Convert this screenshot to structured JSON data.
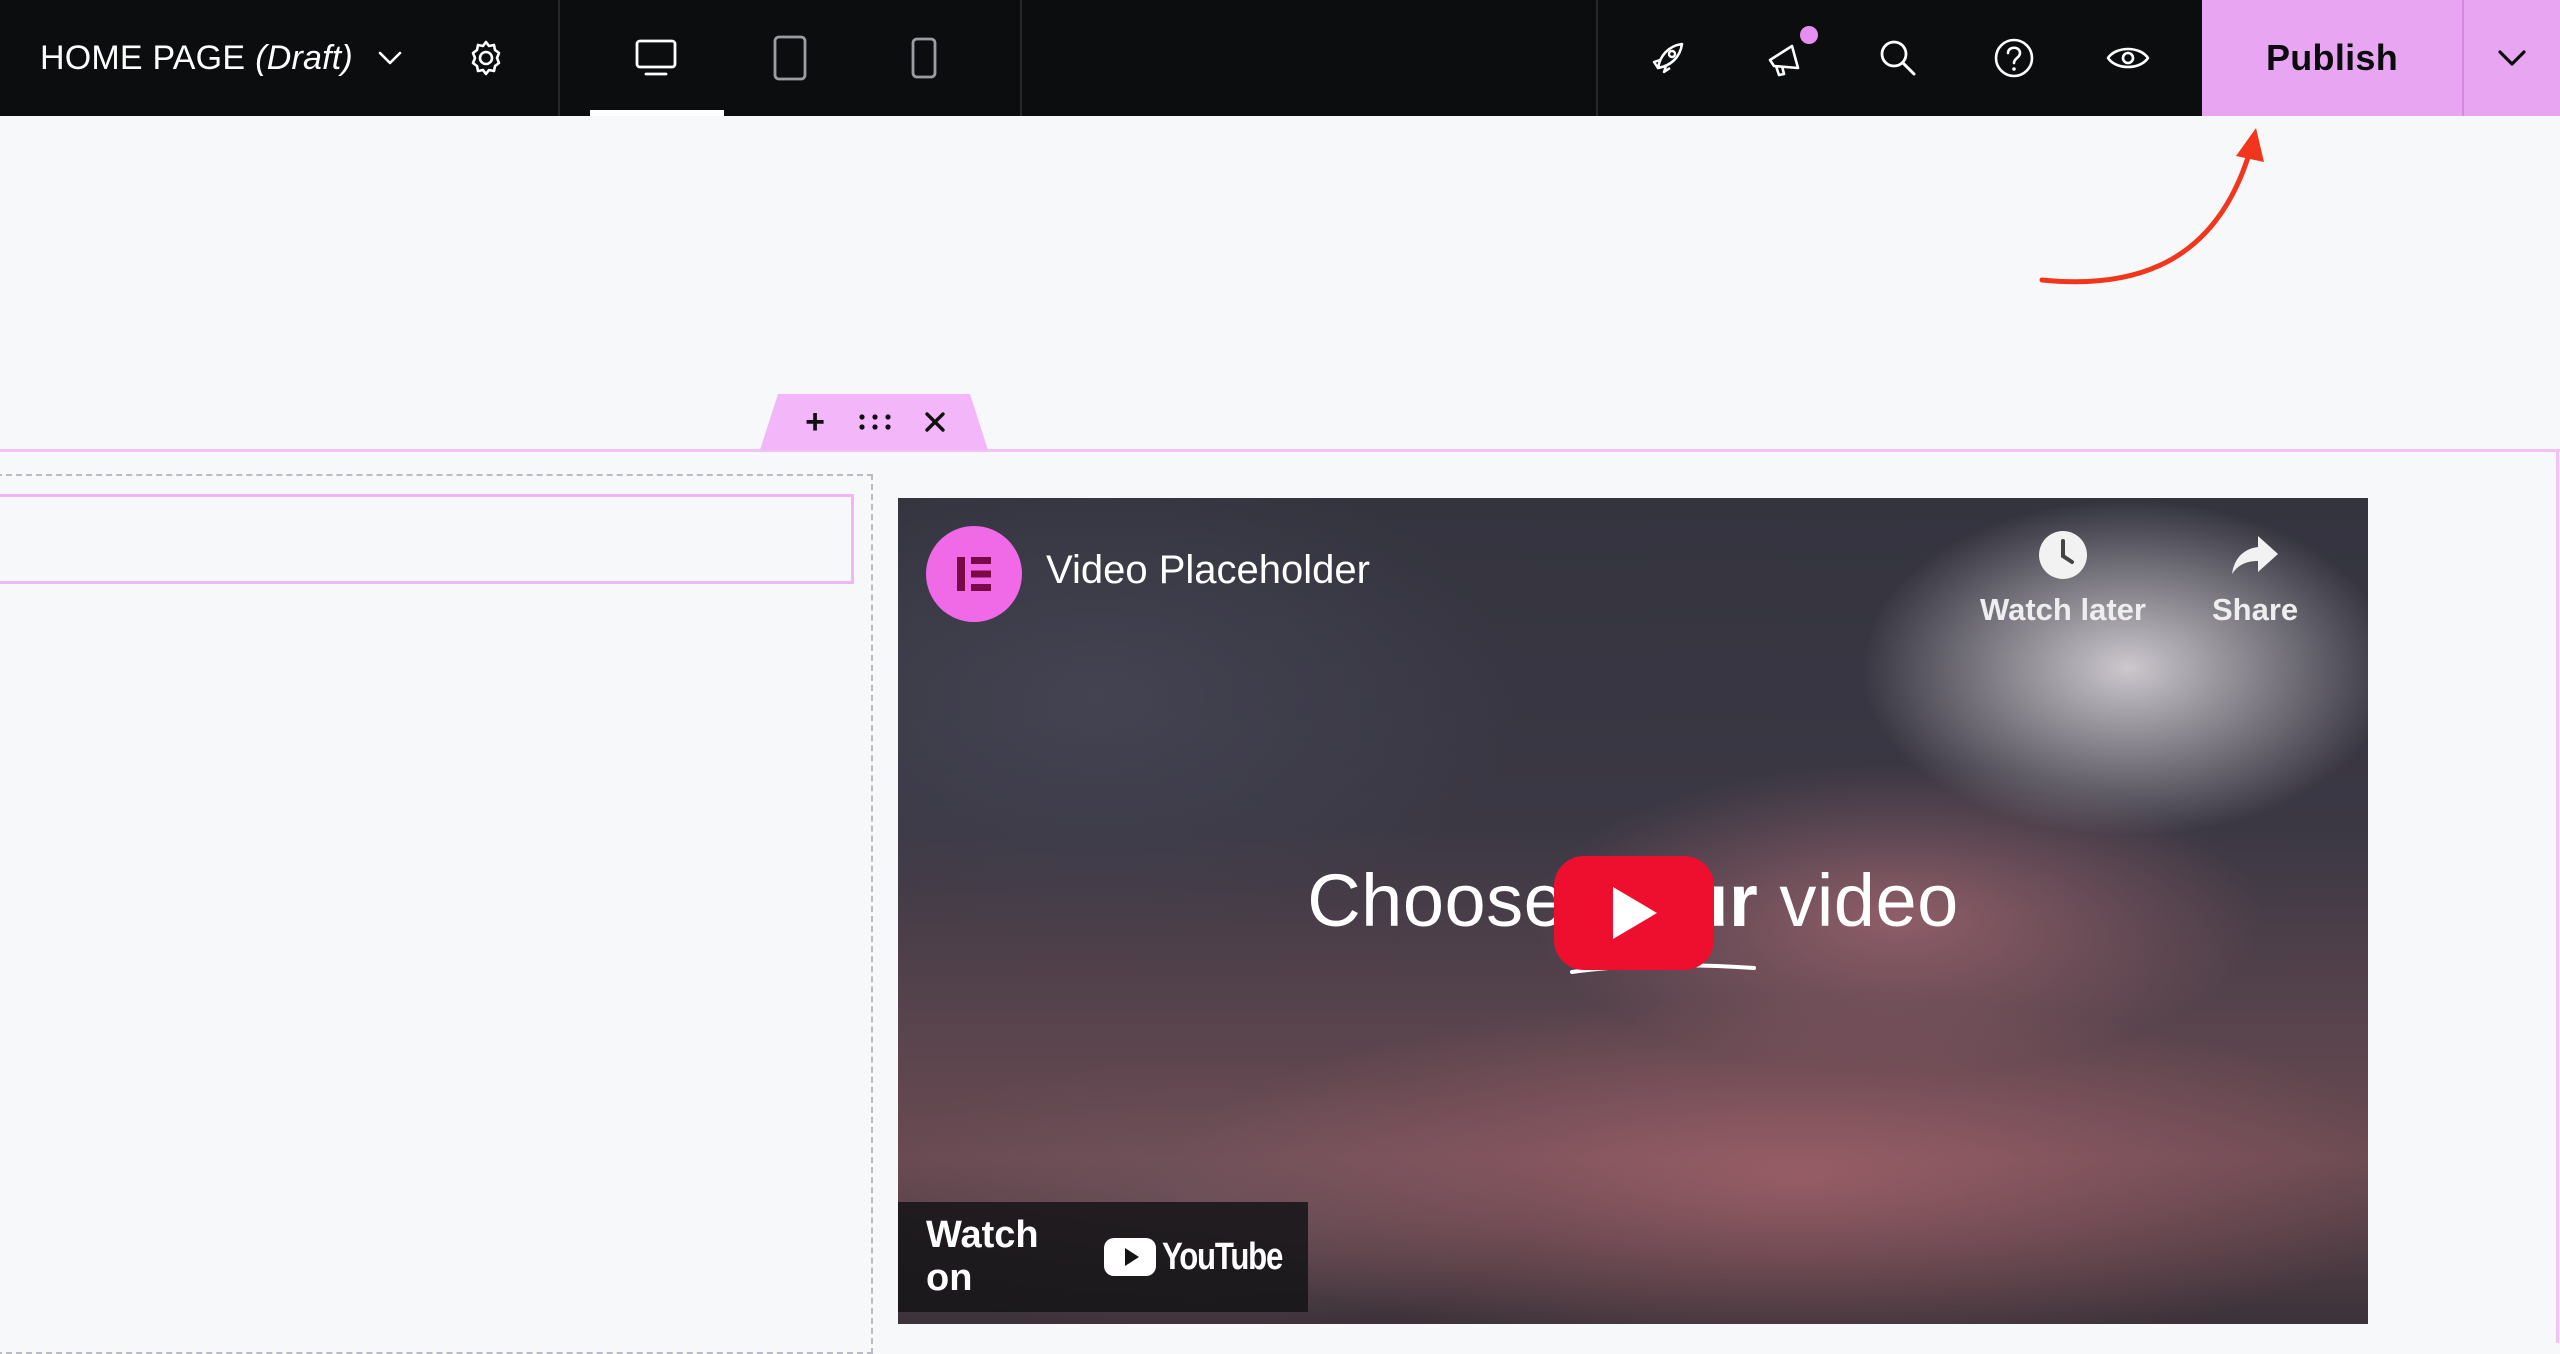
{
  "toolbar": {
    "page_title": "HOME PAGE",
    "page_status": "(Draft)",
    "devices": [
      "desktop",
      "tablet",
      "mobile"
    ],
    "active_device": "desktop",
    "publish_label": "Publish",
    "accent_color": "#e8a6f2"
  },
  "icons": {
    "title_dropdown": "chevron-down-icon",
    "settings": "gear-icon",
    "desktop": "desktop-icon",
    "tablet": "tablet-icon",
    "mobile": "mobile-icon",
    "launch": "rocket-icon",
    "whats_new": "megaphone-icon",
    "search": "search-icon",
    "help": "help-circle-icon",
    "preview": "eye-icon",
    "publish_more": "chevron-down-icon"
  },
  "section_handle": {
    "add": "+",
    "drag": "⠿",
    "remove": "×"
  },
  "video": {
    "title": "Video Placeholder",
    "watch_later": "Watch later",
    "share": "Share",
    "headline_pre": "Choose",
    "headline_mid": "ur",
    "headline_post": "video",
    "watch_on": "Watch on",
    "brand": "YouTube",
    "play_color": "#ee0f2f"
  }
}
